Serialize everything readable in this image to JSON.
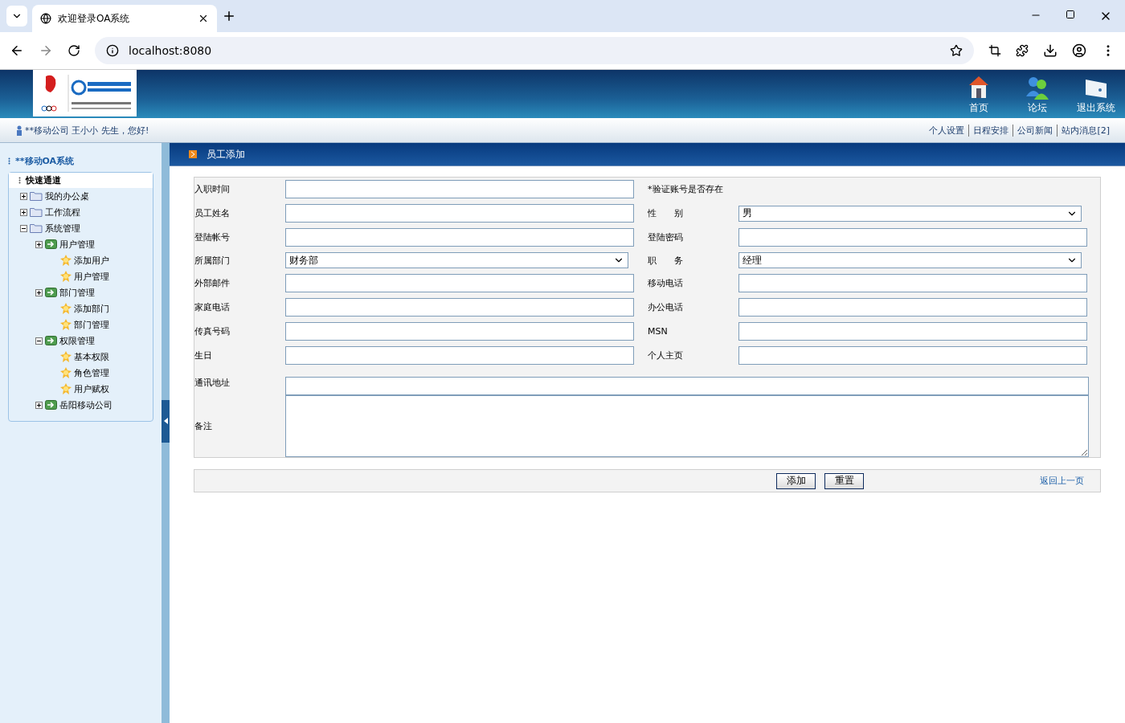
{
  "browser": {
    "tab_title": "欢迎登录OA系统",
    "url": "localhost:8080"
  },
  "header": {
    "nav": [
      {
        "label": "首页",
        "kind": "home"
      },
      {
        "label": "论坛",
        "kind": "forum"
      },
      {
        "label": "退出系统",
        "kind": "exit"
      }
    ]
  },
  "user_bar": {
    "greeting": "**移动公司 王小小 先生，您好!",
    "links": [
      "个人设置",
      "日程安排",
      "公司新闻",
      "站内消息[2]"
    ]
  },
  "sidebar": {
    "title": "**移动OA系统",
    "section": "快速通道",
    "tree": [
      {
        "label": "我的办公桌",
        "kind": "folder",
        "expanded": false
      },
      {
        "label": "工作流程",
        "kind": "folder",
        "expanded": false
      },
      {
        "label": "系统管理",
        "kind": "folder",
        "expanded": true,
        "children": [
          {
            "label": "用户管理",
            "kind": "module",
            "expanded": false,
            "children": [
              {
                "label": "添加用户",
                "kind": "leaf"
              },
              {
                "label": "用户管理",
                "kind": "leaf"
              }
            ]
          },
          {
            "label": "部门管理",
            "kind": "module",
            "expanded": false,
            "children": [
              {
                "label": "添加部门",
                "kind": "leaf"
              },
              {
                "label": "部门管理",
                "kind": "leaf"
              }
            ]
          },
          {
            "label": "权限管理",
            "kind": "module",
            "expanded": true,
            "children": [
              {
                "label": "基本权限",
                "kind": "leaf"
              },
              {
                "label": "角色管理",
                "kind": "leaf"
              },
              {
                "label": "用户赋权",
                "kind": "leaf"
              }
            ]
          },
          {
            "label": "岳阳移动公司",
            "kind": "module",
            "expanded": false
          }
        ]
      }
    ]
  },
  "page_title": "员工添加",
  "form": {
    "rows": [
      {
        "left": {
          "label": "入职时间",
          "kind": "input"
        },
        "right": {
          "kind": "note",
          "text": "*验证账号是否存在"
        }
      },
      {
        "left": {
          "label": "员工姓名",
          "kind": "input"
        },
        "right": {
          "label": "性　　别",
          "kind": "select",
          "value": "男"
        }
      },
      {
        "left": {
          "label": "登陆帐号",
          "kind": "input"
        },
        "right": {
          "label": "登陆密码",
          "kind": "input"
        }
      },
      {
        "left": {
          "label": "所属部门",
          "kind": "select",
          "value": "财务部"
        },
        "right": {
          "label": "职　　务",
          "kind": "select",
          "value": "经理"
        }
      },
      {
        "left": {
          "label": "外部邮件",
          "kind": "input"
        },
        "right": {
          "label": "移动电话",
          "kind": "input"
        }
      },
      {
        "left": {
          "label": "家庭电话",
          "kind": "input"
        },
        "right": {
          "label": "办公电话",
          "kind": "input"
        }
      },
      {
        "left": {
          "label": "传真号码",
          "kind": "input"
        },
        "right": {
          "label": "MSN",
          "kind": "input"
        }
      },
      {
        "left": {
          "label": "生日",
          "kind": "input"
        },
        "right": {
          "label": "个人主页",
          "kind": "input"
        }
      }
    ],
    "address_label": "通讯地址",
    "remarks_label": "备注"
  },
  "buttons": [
    "添加",
    "重置"
  ],
  "back_link": "返回上一页"
}
